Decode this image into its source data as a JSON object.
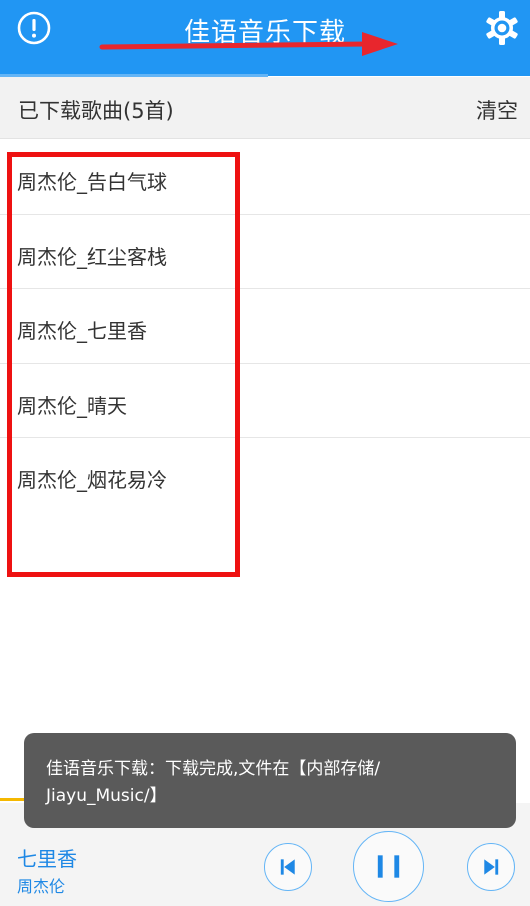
{
  "header": {
    "title": "佳语音乐下载",
    "info_icon": "info-circle-icon",
    "settings_icon": "gear-icon",
    "background_color": "#2196f3"
  },
  "section": {
    "title": "已下载歌曲(5首)",
    "clear_label": "清空"
  },
  "songs": [
    {
      "name": "周杰伦_告白气球"
    },
    {
      "name": "周杰伦_红尘客栈"
    },
    {
      "name": "周杰伦_七里香"
    },
    {
      "name": "周杰伦_晴天"
    },
    {
      "name": "周杰伦_烟花易冷"
    }
  ],
  "annotations": {
    "highlight_color": "#ee1111"
  },
  "toast": {
    "line1": "佳语音乐下载：下载完成,文件在【内部存储/",
    "line2": "Jiayu_Music/】"
  },
  "player": {
    "song_title": "七里香",
    "artist": "周杰伦",
    "prev_icon": "skip-previous-icon",
    "pause_icon": "pause-icon",
    "next_icon": "skip-next-icon",
    "accent_color": "#1e88e5"
  }
}
